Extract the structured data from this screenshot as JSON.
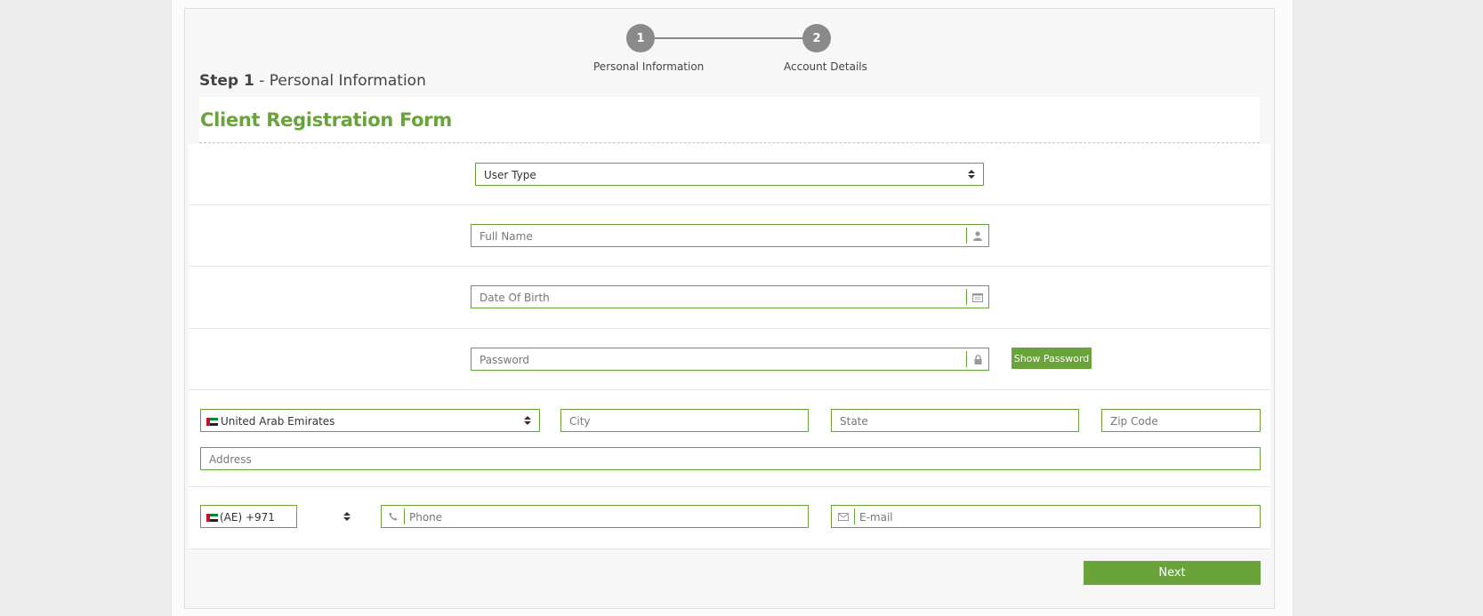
{
  "stepper": {
    "steps": [
      {
        "number": "1",
        "label": "Personal Information"
      },
      {
        "number": "2",
        "label": "Account Details"
      }
    ]
  },
  "step_heading": {
    "step": "Step 1",
    "rest": " - Personal Information"
  },
  "form": {
    "title": "Client Registration Form",
    "user_type": {
      "selected": "User Type"
    },
    "full_name": {
      "placeholder": "Full Name",
      "icon": "user-icon"
    },
    "date_of_birth": {
      "placeholder": "Date Of Birth",
      "icon": "calendar-icon"
    },
    "password": {
      "placeholder": "Password",
      "icon": "lock-icon"
    },
    "show_password_label": "Show Password",
    "country": {
      "selected": "United Arab Emirates",
      "flag": "uae-flag-icon"
    },
    "city": {
      "placeholder": "City"
    },
    "state": {
      "placeholder": "State"
    },
    "zip": {
      "placeholder": "Zip Code"
    },
    "address": {
      "placeholder": "Address"
    },
    "dial_code": {
      "selected": "(AE) +971"
    },
    "phone": {
      "placeholder": "Phone",
      "icon": "phone-icon"
    },
    "email": {
      "placeholder": "E-mail",
      "icon": "envelope-icon"
    },
    "next_label": "Next"
  },
  "colors": {
    "accent": "#6aa33a",
    "step_circle": "#8a8a8a"
  }
}
